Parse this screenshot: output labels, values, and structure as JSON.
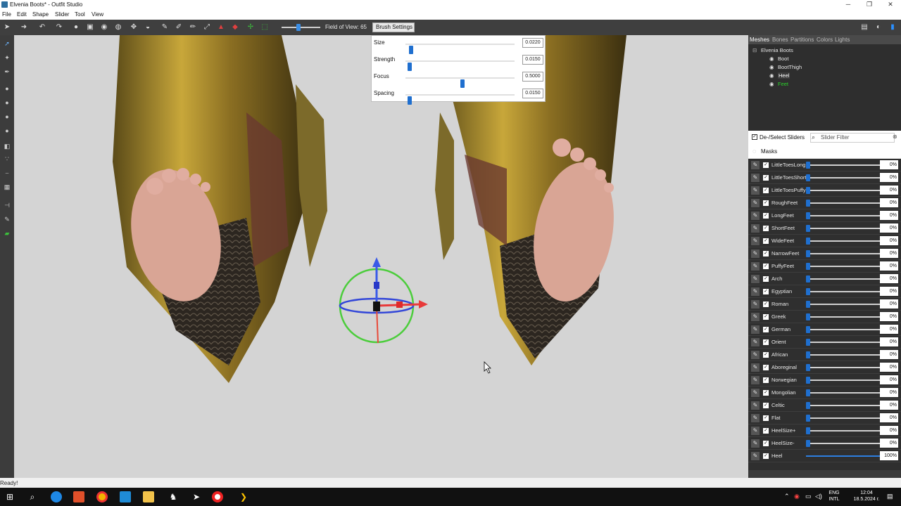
{
  "window": {
    "title": "Elvenia Boots* - Outfit Studio",
    "min": "─",
    "max": "❐",
    "close": "✕"
  },
  "menu": [
    "File",
    "Edit",
    "Shape",
    "Slider",
    "Tool",
    "View"
  ],
  "toolbar": {
    "fov_label": "Field of View: 65",
    "brush_settings_tab": "Brush Settings"
  },
  "brush_settings": {
    "rows": [
      {
        "label": "Size",
        "value": "0.0220",
        "level": 0.03
      },
      {
        "label": "Strength",
        "value": "0.0150",
        "level": 0.02
      },
      {
        "label": "Focus",
        "value": "0.5000",
        "level": 0.5
      },
      {
        "label": "Spacing",
        "value": "0.0150",
        "level": 0.02
      }
    ]
  },
  "right_panel": {
    "tabs": [
      "Meshes",
      "Bones",
      "Partitions",
      "Colors",
      "Lights"
    ],
    "tree_root": "Elvenia Boots",
    "meshes": [
      {
        "name": "Boot",
        "color": "#e6e6e6",
        "selected": false
      },
      {
        "name": "BootThigh",
        "color": "#e6e6e6",
        "selected": false
      },
      {
        "name": "Heel",
        "color": "#ffffff",
        "selected": true
      },
      {
        "name": "Feet",
        "color": "#2bd12b",
        "selected": false
      }
    ],
    "select_sliders_label": "De-/Select Sliders",
    "slider_filter_placeholder": "Slider Filter",
    "masks_label": "Masks",
    "sliders": [
      {
        "name": "LittleToesLong",
        "value": "0%",
        "level": 0.0
      },
      {
        "name": "LittleToesShort",
        "value": "0%",
        "level": 0.0
      },
      {
        "name": "LittleToesPuffy",
        "value": "0%",
        "level": 0.0
      },
      {
        "name": "RoughFeet",
        "value": "0%",
        "level": 0.0
      },
      {
        "name": "LongFeet",
        "value": "0%",
        "level": 0.0
      },
      {
        "name": "ShortFeet",
        "value": "0%",
        "level": 0.0
      },
      {
        "name": "WideFeet",
        "value": "0%",
        "level": 0.0
      },
      {
        "name": "NarrowFeet",
        "value": "0%",
        "level": 0.0
      },
      {
        "name": "PuffyFeet",
        "value": "0%",
        "level": 0.0
      },
      {
        "name": "Arch",
        "value": "0%",
        "level": 0.0
      },
      {
        "name": "Egyptian",
        "value": "0%",
        "level": 0.0
      },
      {
        "name": "Roman",
        "value": "0%",
        "level": 0.0
      },
      {
        "name": "Greek",
        "value": "0%",
        "level": 0.0
      },
      {
        "name": "German",
        "value": "0%",
        "level": 0.0
      },
      {
        "name": "Orient",
        "value": "0%",
        "level": 0.0
      },
      {
        "name": "African",
        "value": "0%",
        "level": 0.0
      },
      {
        "name": "Aboreginal",
        "value": "0%",
        "level": 0.0
      },
      {
        "name": "Norwegian",
        "value": "0%",
        "level": 0.0
      },
      {
        "name": "Mongolian",
        "value": "0%",
        "level": 0.0
      },
      {
        "name": "Celtic",
        "value": "0%",
        "level": 0.0
      },
      {
        "name": "Flat",
        "value": "0%",
        "level": 0.0
      },
      {
        "name": "HeelSize+",
        "value": "0%",
        "level": 0.0
      },
      {
        "name": "HeelSize-",
        "value": "0%",
        "level": 0.0
      },
      {
        "name": "Heel",
        "value": "100%",
        "level": 1.0
      }
    ]
  },
  "status": {
    "text": "Ready!"
  },
  "taskbar": {
    "lang_top": "ENG",
    "lang_bottom": "INTL",
    "time": "12:04",
    "date": "18.5.2024 г."
  }
}
